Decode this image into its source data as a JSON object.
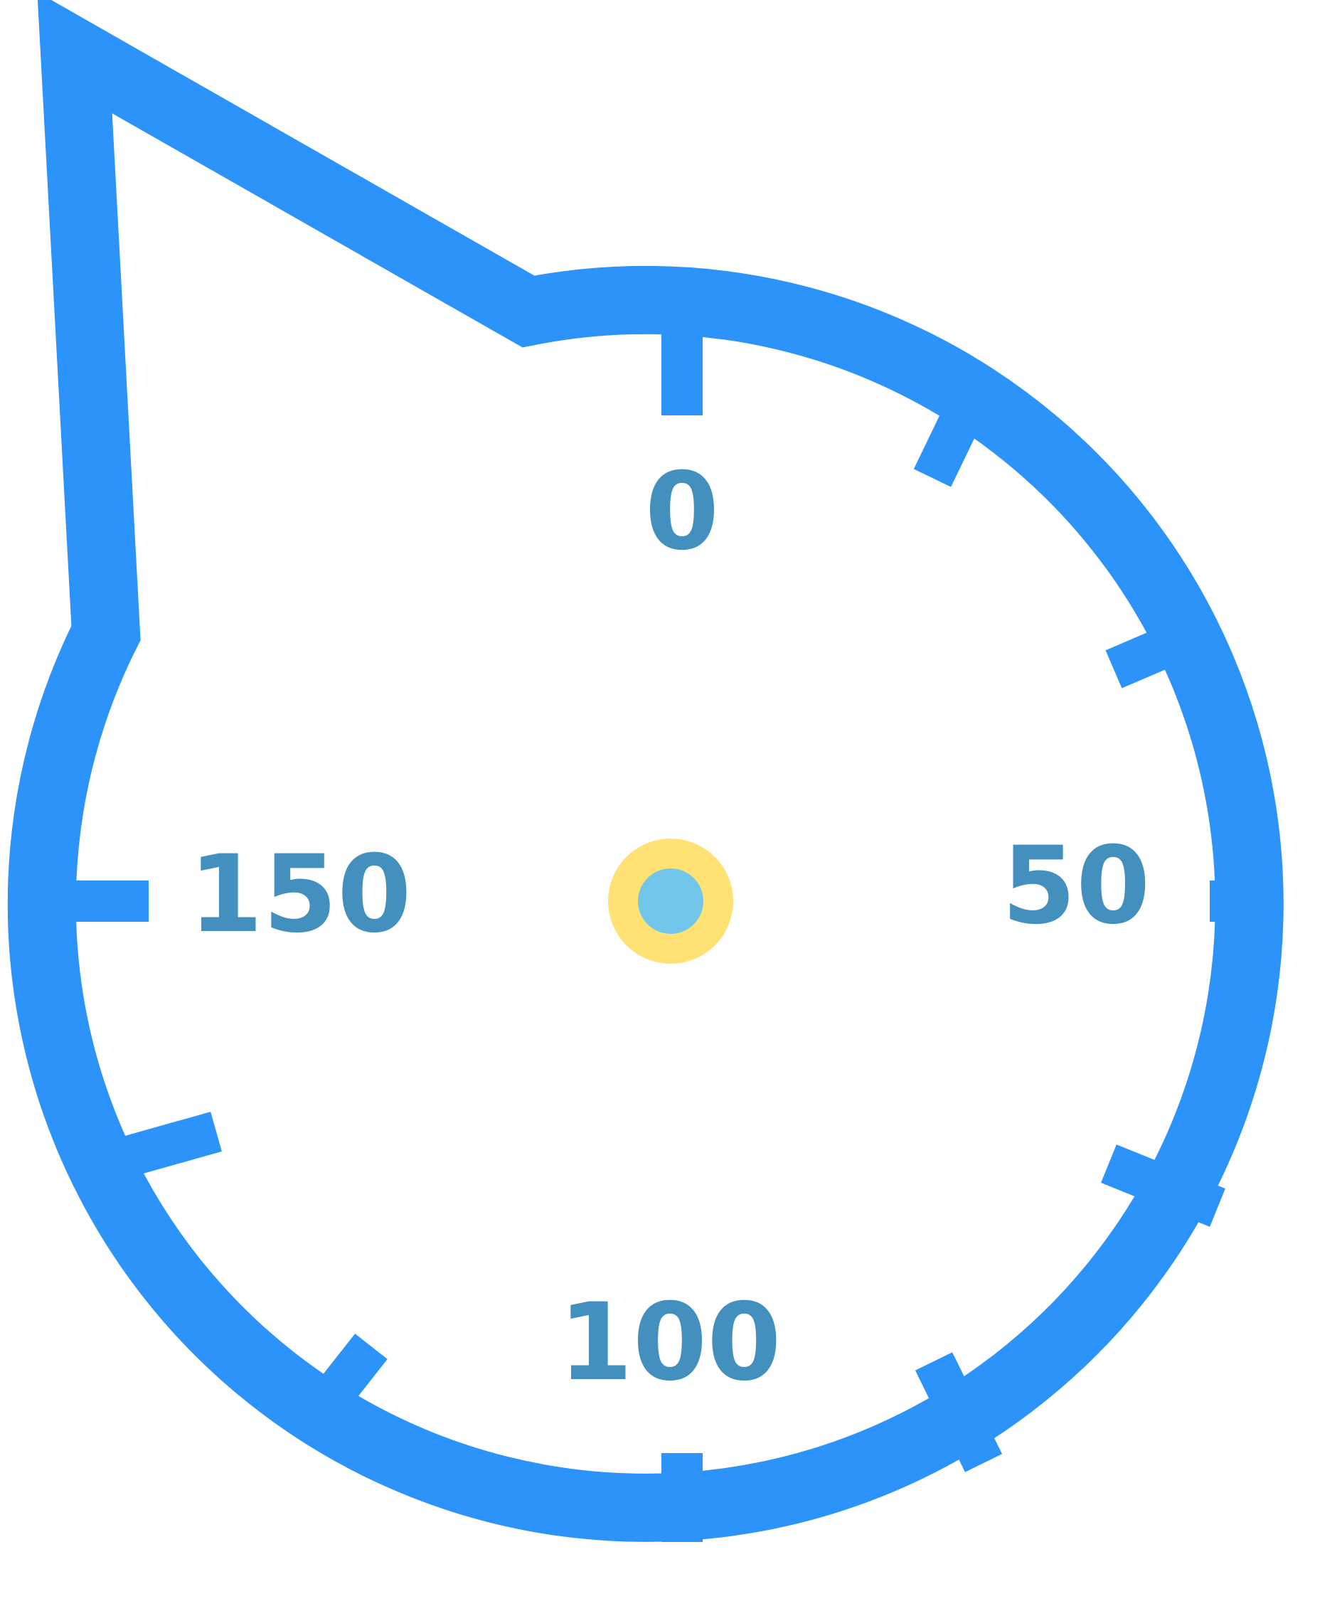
{
  "dial": {
    "labels": {
      "top": "0",
      "right": "50",
      "bottom": "100",
      "left": "150"
    }
  },
  "colors": {
    "outline": "#2C93FA",
    "label": "#4390BE",
    "center_ring": "#FFE273",
    "center_dot": "#72C6EA",
    "background": "#FFFFFF"
  }
}
